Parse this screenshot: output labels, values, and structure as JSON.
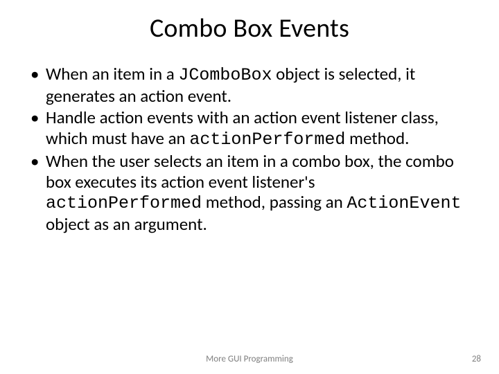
{
  "title": "Combo Box Events",
  "bullets": {
    "b1": {
      "t1": "When an item in a ",
      "c1": "JComboBox",
      "t2": " object is selected, it generates an action event."
    },
    "b2": {
      "t1": "Handle action events with an action event listener class, which must have an ",
      "c1": "actionPerformed",
      "t2": " method."
    },
    "b3": {
      "t1": "When the user selects an item in a combo box, the combo box executes its action event listener's ",
      "c1": "actionPerformed",
      "t2": " method, passing an ",
      "c2": "ActionEvent",
      "t3": " object as an argument."
    }
  },
  "footer": {
    "center": "More GUI Programming",
    "page": "28"
  }
}
